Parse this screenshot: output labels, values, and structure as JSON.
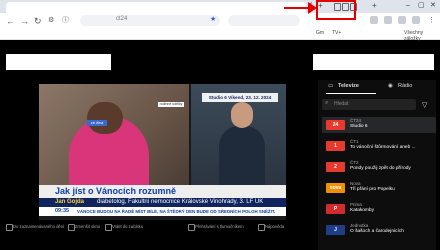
{
  "browser": {
    "url_text": "ct24",
    "bookmarks_right": "Všechny záložky",
    "bookmark_items": [
      "Gm",
      "TV+"
    ]
  },
  "player": {
    "live_tag": "ze živa",
    "studio_badge": "Studio 6 Víkend, 23. 12. 2024",
    "small_badge": "rodinné udělky",
    "headline": "Jak jíst o Vánocích rozumně",
    "name": "Jan Gojda",
    "desc": "diabetolog, Fakultní nemocnice Královské Vinohrady, 3. LF UK",
    "ticker_time": "09:35",
    "ticker_text": "VÁNOCE BUDOU NA ŘADĚ MÍST BÍLÉ, NA ŠTĚDRÝ DEN BUDE OD SŘEDNÍCH POLOH SNĚŽIT."
  },
  "controls": [
    "Do zaznamenávaného dění",
    "Zmenšit okno",
    "Vrátit do začátku",
    "Přehrávání s tlumočníkem",
    "Nápověda"
  ],
  "panel": {
    "tab_tv": "Televize",
    "tab_radio": "Rádio",
    "search_placeholder": "Hledat",
    "channels": [
      {
        "name": "ČT24",
        "program": "Studio 6",
        "logo": "24",
        "color": "#e63a2f",
        "textcolor": "#ffffff"
      },
      {
        "name": "ČT1",
        "program": "To vánoční štůrmování aneb ...",
        "logo": "1",
        "color": "#e63a2f",
        "textcolor": "#ffffff"
      },
      {
        "name": "ČT2",
        "program": "Pondy použij zpět do přírody",
        "logo": "2",
        "color": "#e63a2f",
        "textcolor": "#ffffff"
      },
      {
        "name": "Nova",
        "program": "Tři přání pro Popelku",
        "logo": "nova",
        "color": "#f28f00",
        "textcolor": "#ffffff"
      },
      {
        "name": "Prima",
        "program": "Katakomby",
        "logo": "P",
        "color": "#d12b2b",
        "textcolor": "#ffffff"
      },
      {
        "name": "Jednotka",
        "program": "O šašoch a čarodejnicích",
        "logo": "J",
        "color": "#1f3e86",
        "textcolor": "#ffffff"
      }
    ]
  }
}
